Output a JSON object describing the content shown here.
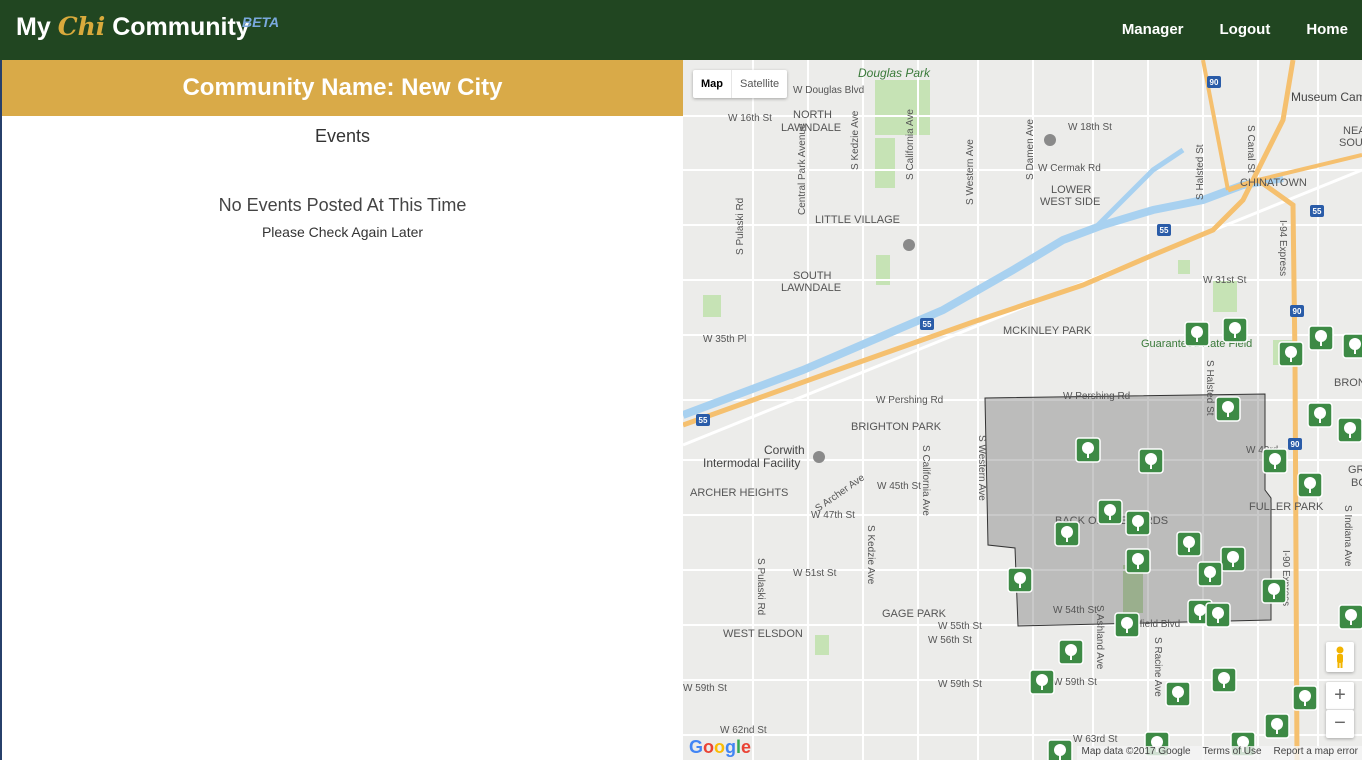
{
  "brand": {
    "my": "My",
    "chi": "Chi",
    "community": "Community",
    "beta": "BETA"
  },
  "nav": [
    "Manager",
    "Logout",
    "Home"
  ],
  "community": {
    "title": "Community Name: New City"
  },
  "events": {
    "heading": "Events",
    "empty_title": "No Events Posted At This Time",
    "empty_sub": "Please Check Again Later"
  },
  "map": {
    "maptype": {
      "map": "Map",
      "satellite": "Satellite"
    },
    "zoom_in": "+",
    "zoom_out": "−",
    "attribution": {
      "data": "Map data ©2017 Google",
      "terms": "Terms of Use",
      "report": "Report a map error"
    },
    "google_logo": "Google",
    "labels": [
      "Douglas Park",
      "W Douglas Blvd",
      "NORTH",
      "LAWNDALE",
      "W 16th St",
      "W 18th St",
      "Museum Camp",
      "NEA",
      "SOUTH",
      "W Cermak Rd",
      "LOWER",
      "WEST SIDE",
      "CHINATOWN",
      "LITTLE VILLAGE",
      "SOUTH",
      "LAWNDALE",
      "W 31st St",
      "MCKINLEY PARK",
      "Guaranteed Rate Field",
      "BRON",
      "W 35th Pl",
      "W Pershing Rd",
      "W Pershing Rd",
      "BRIGHTON PARK",
      "Corwith",
      "Intermodal Facility",
      "W 43rd",
      "ARCHER HEIGHTS",
      "W 45th St",
      "S Archer Ave",
      "W 47th St",
      "FULLER PARK",
      "BACK OF THE YARDS",
      "W 51st St",
      "W 54th St",
      "GAGE PARK",
      "W 55th St",
      "W 56th St",
      "Garfield Blvd",
      "WEST ELSDON",
      "W 59th St",
      "W 59th St",
      "W 59th St",
      "W 62nd St",
      "W 63rd St",
      "S Pulaski Rd",
      "S Kedzie Ave",
      "S California Ave",
      "S Western Ave",
      "S Damen Ave",
      "S Ashland Ave",
      "S Halsted St",
      "S Racine Ave",
      "Central Park Avenue",
      "I-94 Express",
      "S Canal St",
      "S Indiana Ave",
      "GRA",
      "BOU",
      "S Pulaski Rd",
      "S Kedzie Ave",
      "S California Ave",
      "S Western Ave",
      "S Halsted St",
      "I-90 Express"
    ],
    "shields": [
      "90",
      "55",
      "55",
      "55",
      "55",
      "90",
      "90"
    ]
  }
}
